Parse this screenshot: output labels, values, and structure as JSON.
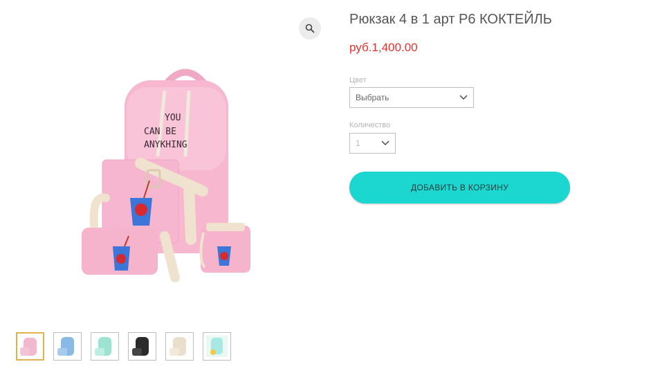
{
  "product": {
    "title": "Рюкзак 4 в 1 арт P6 КОКТЕЙЛЬ",
    "price": "руб.1,400.00",
    "price_color": "#e3342f",
    "backpack_text": [
      "YOU",
      "CAN BE",
      "ANYKHING"
    ]
  },
  "options": {
    "color_label": "Цвет",
    "color_value": "Выбрать",
    "quantity_label": "Количество",
    "quantity_value": "1"
  },
  "actions": {
    "add_to_cart": "ДОБАВИТЬ В КОРЗИНУ",
    "button_color": "#1bd7d0"
  },
  "gallery": {
    "zoom_icon": "magnifier-icon",
    "thumbnails": [
      {
        "color": "#f2b8cf",
        "selected": true
      },
      {
        "color": "#8ab9e6",
        "selected": false
      },
      {
        "color": "#9ee3d2",
        "selected": false
      },
      {
        "color": "#2a2a2a",
        "selected": false
      },
      {
        "color": "#e8e0cc",
        "selected": false
      },
      {
        "color": "#a8e8e2",
        "selected": false
      }
    ]
  }
}
